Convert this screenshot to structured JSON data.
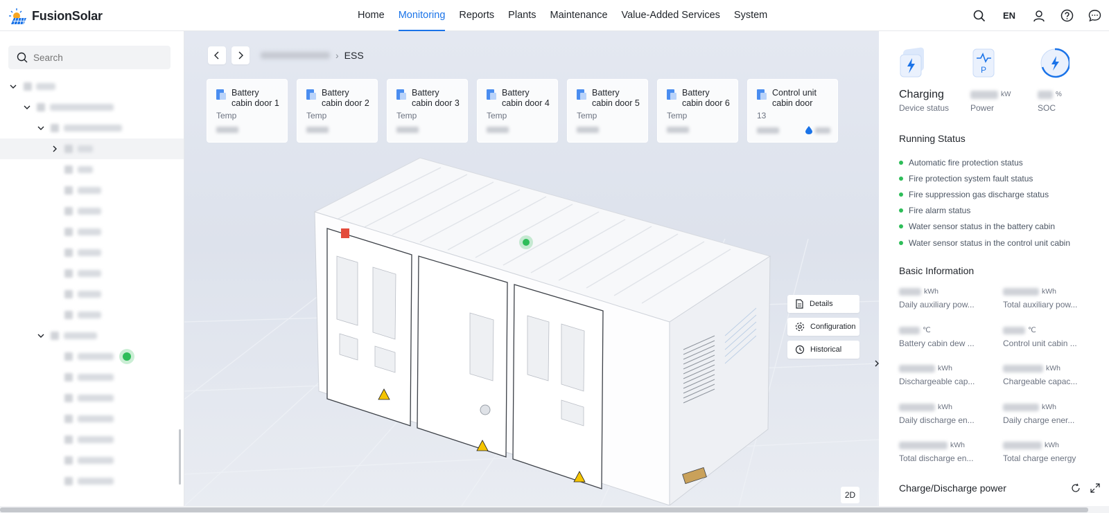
{
  "app": {
    "name": "FusionSolar",
    "language": "EN"
  },
  "nav": {
    "items": [
      "Home",
      "Monitoring",
      "Reports",
      "Plants",
      "Maintenance",
      "Value-Added Services",
      "System"
    ],
    "active_index": 1
  },
  "sidebar": {
    "search_placeholder": "Search"
  },
  "breadcrumb": {
    "current": "ESS"
  },
  "doors": [
    {
      "title": "Battery cabin door 1",
      "label": "Temp"
    },
    {
      "title": "Battery cabin door 2",
      "label": "Temp"
    },
    {
      "title": "Battery cabin door 3",
      "label": "Temp"
    },
    {
      "title": "Battery cabin door 4",
      "label": "Temp"
    },
    {
      "title": "Battery cabin door 5",
      "label": "Temp"
    },
    {
      "title": "Battery cabin door 6",
      "label": "Temp"
    },
    {
      "title": "Control unit cabin door",
      "label": "13"
    }
  ],
  "scene_actions": {
    "details": "Details",
    "configuration": "Configuration",
    "historical": "Historical",
    "view_mode": "2D"
  },
  "kpis": {
    "status": {
      "value": "Charging",
      "label": "Device status"
    },
    "power": {
      "unit": "kW",
      "label": "Power"
    },
    "soc": {
      "unit": "%",
      "label": "SOC"
    }
  },
  "running_status": {
    "title": "Running Status",
    "items": [
      "Automatic fire protection status",
      "Fire protection system fault status",
      "Fire suppression gas discharge status",
      "Fire alarm status",
      "Water sensor status in the battery cabin",
      "Water sensor status in the control unit cabin"
    ]
  },
  "basic_info": {
    "title": "Basic Information",
    "items": [
      {
        "unit": "kWh",
        "label": "Daily auxiliary pow..."
      },
      {
        "unit": "kWh",
        "label": "Total auxiliary pow..."
      },
      {
        "unit": "℃",
        "label": "Battery cabin dew ..."
      },
      {
        "unit": "℃",
        "label": "Control unit cabin ..."
      },
      {
        "unit": "kWh",
        "label": "Dischargeable cap..."
      },
      {
        "unit": "kWh",
        "label": "Chargeable capac..."
      },
      {
        "unit": "kWh",
        "label": "Daily discharge en..."
      },
      {
        "unit": "kWh",
        "label": "Daily charge ener..."
      },
      {
        "unit": "kWh",
        "label": "Total discharge en..."
      },
      {
        "unit": "kWh",
        "label": "Total charge energy"
      }
    ]
  },
  "charge_discharge": {
    "title": "Charge/Discharge power"
  },
  "colors": {
    "accent": "#1a73e8",
    "status_ok": "#2ebd59"
  }
}
